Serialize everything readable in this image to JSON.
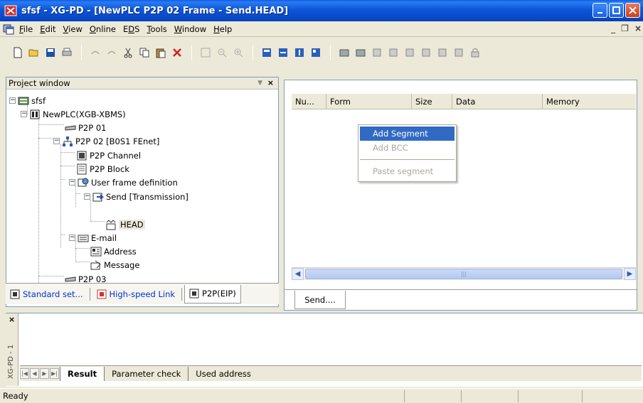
{
  "window": {
    "title": "sfsf - XG-PD - [NewPLC P2P 02 Frame - Send.HEAD]",
    "icon": "app-logo-icon"
  },
  "menubar": {
    "items": [
      {
        "label": "File",
        "key": "F"
      },
      {
        "label": "Edit",
        "key": "E"
      },
      {
        "label": "View",
        "key": "V"
      },
      {
        "label": "Online",
        "key": "O"
      },
      {
        "label": "EDS",
        "key": "D"
      },
      {
        "label": "Tools",
        "key": "T"
      },
      {
        "label": "Window",
        "key": "W"
      },
      {
        "label": "Help",
        "key": "H"
      }
    ]
  },
  "project_window": {
    "title": "Project window",
    "tree": [
      {
        "label": "sfsf",
        "icon": "project-icon"
      },
      {
        "label": "NewPLC(XGB-XBMS)",
        "icon": "plc-icon"
      },
      {
        "label": "P2P 01",
        "icon": "p2p-icon"
      },
      {
        "label": "P2P 02 [B0S1 FEnet]",
        "icon": "network-icon"
      },
      {
        "label": "P2P Channel",
        "icon": "channel-icon"
      },
      {
        "label": "P2P Block",
        "icon": "block-icon"
      },
      {
        "label": "User frame definition",
        "icon": "frame-def-icon"
      },
      {
        "label": "Send  [Transmission]",
        "icon": "send-icon"
      },
      {
        "label": "HEAD",
        "icon": "head-icon"
      },
      {
        "label": "E-mail",
        "icon": "email-icon"
      },
      {
        "label": "Address",
        "icon": "address-icon"
      },
      {
        "label": "Message",
        "icon": "message-icon"
      },
      {
        "label": "P2P 03",
        "icon": "p2p-icon"
      }
    ],
    "tabs": [
      {
        "label": "Standard set..."
      },
      {
        "label": "High-speed Link"
      },
      {
        "label": "P2P(EIP)"
      }
    ]
  },
  "editor": {
    "columns": [
      "Nu...",
      "Form",
      "Size",
      "Data",
      "Memory"
    ],
    "tab": "Send...."
  },
  "context_menu": {
    "items": [
      {
        "label": "Add Segment",
        "enabled": true
      },
      {
        "label": "Add BCC",
        "enabled": false
      },
      {
        "label": "Paste segment",
        "enabled": false
      }
    ]
  },
  "output": {
    "side_label": "XG-PD - 1",
    "tabs": [
      "Result",
      "Parameter check",
      "Used address"
    ]
  },
  "status": {
    "text": "Ready"
  },
  "colors": {
    "titlebar": "#0b56d8",
    "selection": "#316ac5",
    "chrome": "#ece9d8"
  }
}
